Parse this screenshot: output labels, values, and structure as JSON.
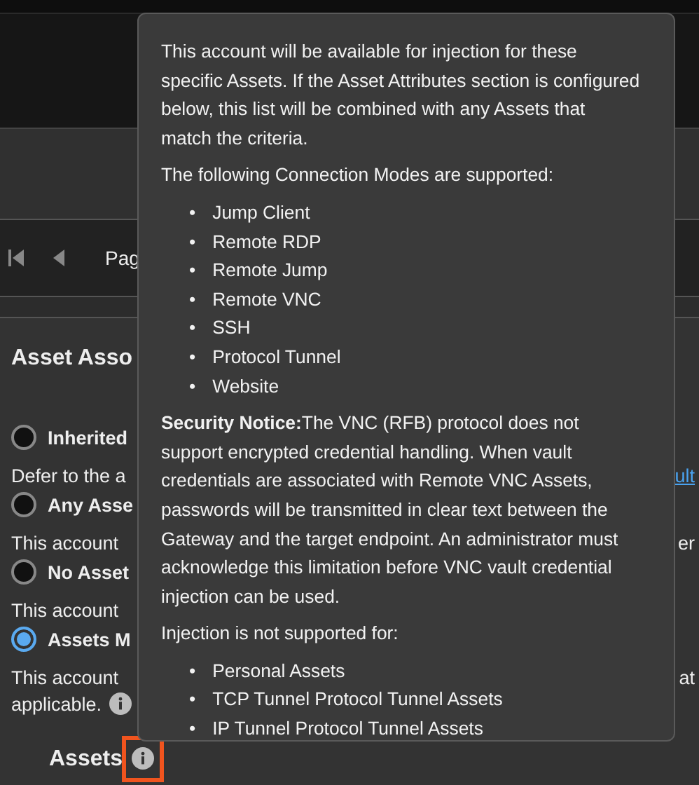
{
  "pager": {
    "page_label": "Pag"
  },
  "section": {
    "title": "Asset Asso",
    "options": [
      {
        "label": "Inherited",
        "selected": false,
        "description": "Defer to the a",
        "trailing": {
          "kind": "link",
          "text": "ult"
        }
      },
      {
        "label": "Any Asse",
        "selected": false,
        "description": "This account",
        "trailing": {
          "kind": "text",
          "text": "er"
        }
      },
      {
        "label": "No Asset",
        "selected": false,
        "description": "This account"
      },
      {
        "label": "Assets M",
        "selected": true,
        "description": "This account",
        "trailing": {
          "kind": "text",
          "text": "at"
        },
        "continuation": "applicable."
      }
    ],
    "subheading": "Assets"
  },
  "tooltip": {
    "blocks": [
      {
        "kind": "text",
        "text": "This account will be available for injection for these specific Assets. If the Asset Attributes section is configured below, this list will be combined with any Assets that match the criteria."
      },
      {
        "kind": "text",
        "text": "The following Connection Modes are supported:"
      },
      {
        "kind": "list",
        "marker": "•",
        "items": [
          "Jump Client",
          "Remote RDP",
          "Remote Jump",
          "Remote VNC",
          "SSH",
          "Protocol Tunnel",
          "Website"
        ]
      },
      {
        "kind": "text",
        "text": "**Security Notice:**The VNC (RFB) protocol does not support encrypted credential handling. When vault credentials are associated with Remote VNC Assets, passwords will be transmitted in clear text between the Gateway and the target endpoint. An administrator must acknowledge this limitation before VNC vault credential injection can be used."
      },
      {
        "kind": "text",
        "text": "Injection is not supported for:"
      },
      {
        "kind": "list",
        "marker": "•",
        "items": [
          "Personal Assets",
          "TCP Tunnel Protocol Tunnel Assets",
          "IP Tunnel Protocol Tunnel Assets"
        ]
      }
    ]
  }
}
